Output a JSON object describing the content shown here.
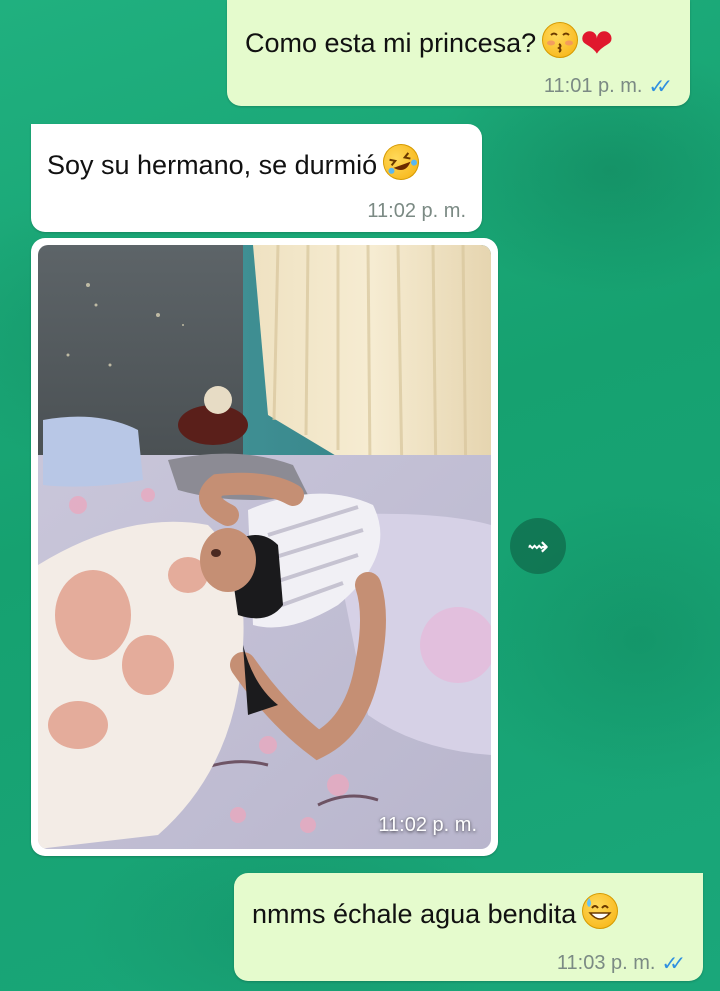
{
  "messages": [
    {
      "text": "Como esta mi princesa?",
      "time": "11:01 p. m.",
      "ticks": "✓✓"
    },
    {
      "text": "Soy su hermano, se durmió",
      "time": "11:02 p. m."
    },
    {
      "image_caption_time": "11:02 p. m.",
      "image_label": "Photo of a girl asleep on a bed"
    },
    {
      "text": "nmms échale agua bendita",
      "time": "11:03 p. m.",
      "ticks": "✓✓"
    }
  ],
  "forward_icon": "forward-icon",
  "colors": {
    "wallpaper": "#1aa677",
    "outgoing_bubble": "#e5fbcd",
    "incoming_bubble": "#ffffff",
    "read_ticks": "#2f8fe0"
  }
}
